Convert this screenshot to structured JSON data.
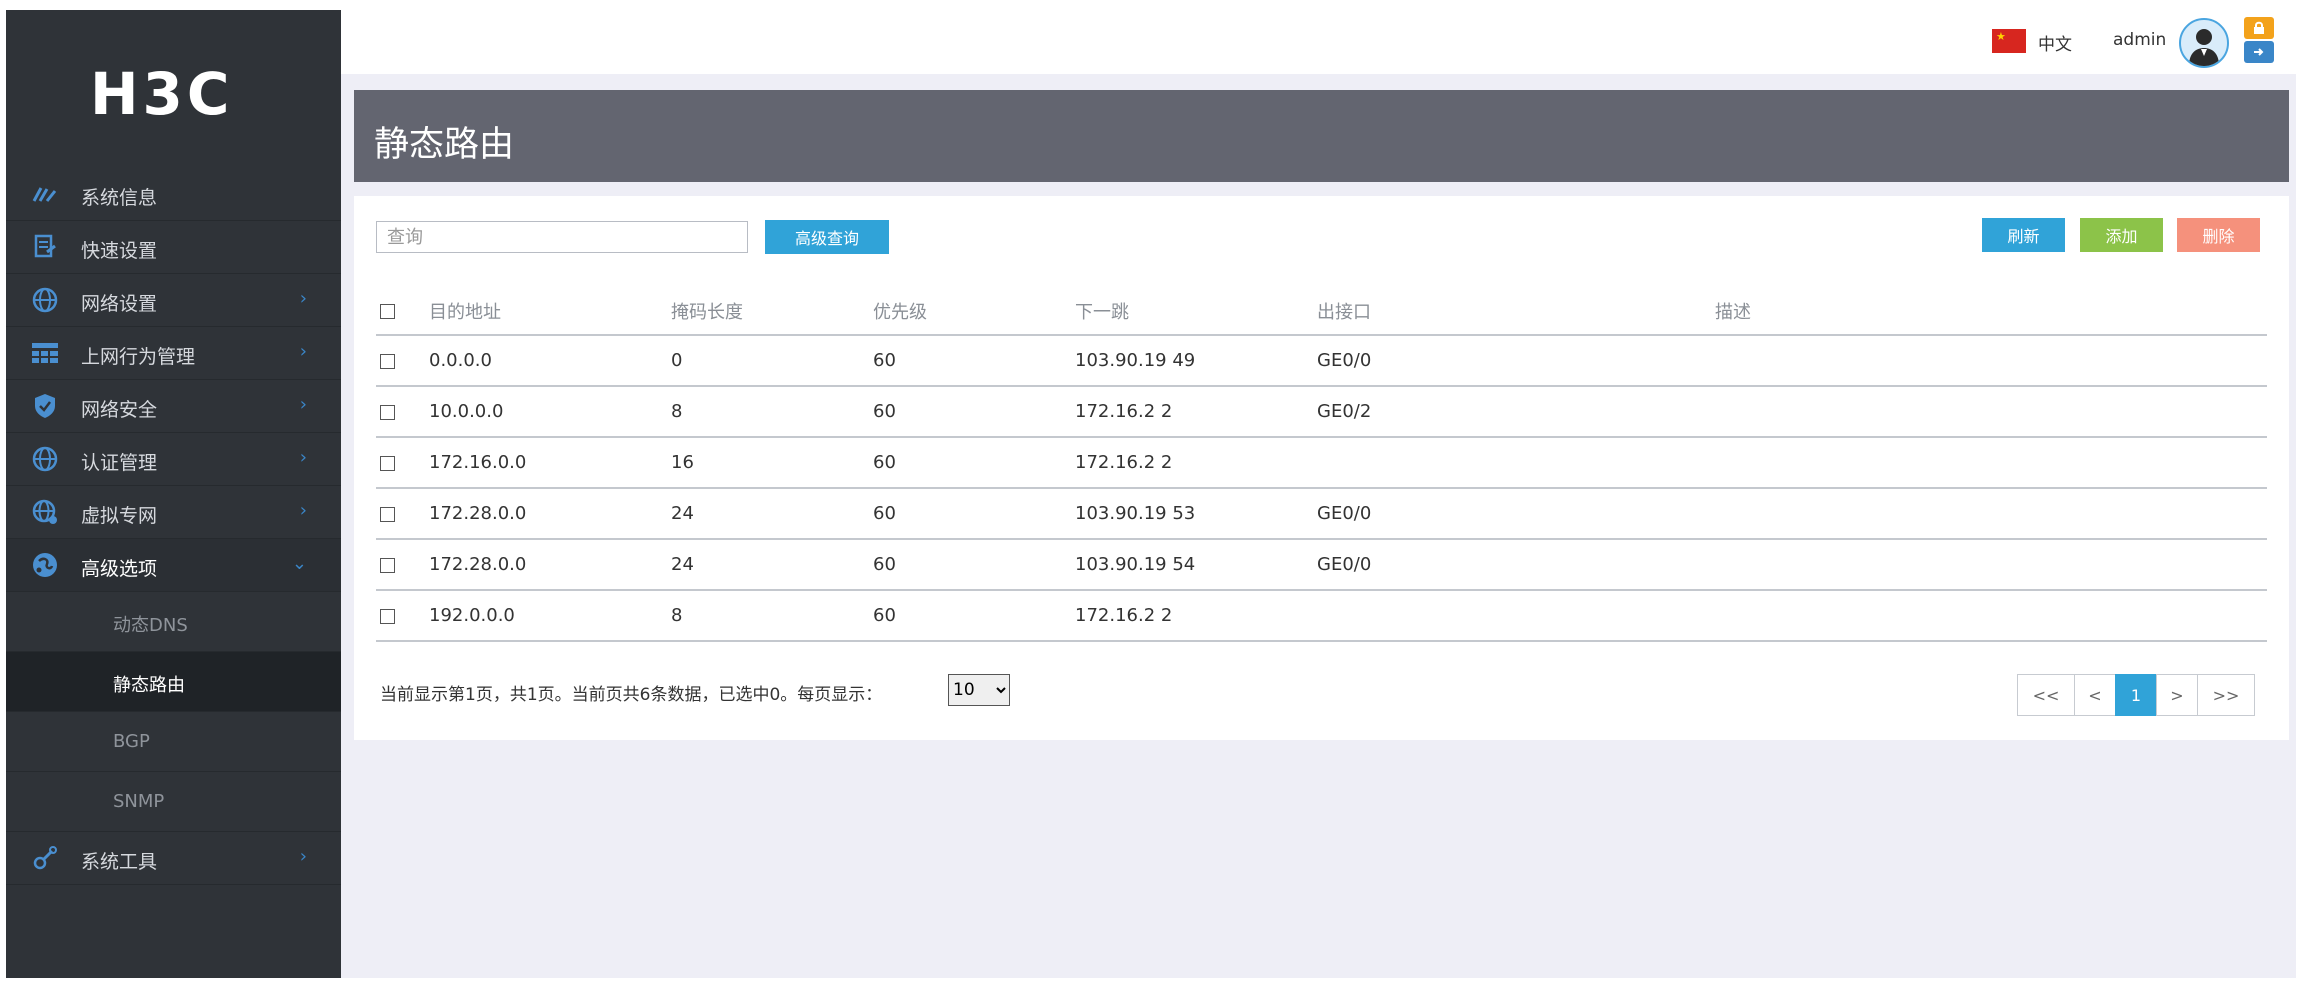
{
  "brand": {
    "logo_text": "H3C"
  },
  "header": {
    "language": "中文",
    "username": "admin",
    "avatar_icon": "user-avatar-icon",
    "lock_icon": "lock-icon",
    "logout_icon": "logout-icon"
  },
  "sidebar": {
    "items": [
      {
        "label": "系统信息",
        "icon": "speedometer-icon"
      },
      {
        "label": "快速设置",
        "icon": "quick-setup-icon"
      },
      {
        "label": "网络设置",
        "icon": "globe-icon",
        "chevron": "›"
      },
      {
        "label": "上网行为管理",
        "icon": "grid-icon",
        "chevron": "›"
      },
      {
        "label": "网络安全",
        "icon": "shield-icon",
        "chevron": "›"
      },
      {
        "label": "认证管理",
        "icon": "globe-icon",
        "chevron": "›"
      },
      {
        "label": "虚拟专网",
        "icon": "globe-network-icon",
        "chevron": "›"
      },
      {
        "label": "高级选项",
        "icon": "advanced-icon",
        "chevron": "⌄"
      },
      {
        "label": "系统工具",
        "icon": "tools-icon",
        "chevron": "›"
      }
    ],
    "sub_items": [
      {
        "label": "动态DNS"
      },
      {
        "label": "静态路由"
      },
      {
        "label": "BGP"
      },
      {
        "label": "SNMP"
      }
    ]
  },
  "page": {
    "title": "静态路由"
  },
  "toolbar": {
    "search_placeholder": "查询",
    "advanced_search": "高级查询",
    "refresh": "刷新",
    "add": "添加",
    "delete": "删除"
  },
  "table": {
    "headers": [
      "目的地址",
      "掩码长度",
      "优先级",
      "下一跳",
      "出接口",
      "描述"
    ],
    "rows": [
      [
        "0.0.0.0",
        "0",
        "60",
        "103.90.19  49",
        "GE0/0",
        ""
      ],
      [
        "10.0.0.0",
        "8",
        "60",
        "172.16.2  2",
        "GE0/2",
        ""
      ],
      [
        "172.16.0.0",
        "16",
        "60",
        "172.16.2  2",
        "",
        ""
      ],
      [
        "172.28.0.0",
        "24",
        "60",
        "103.90.19  53",
        "GE0/0",
        ""
      ],
      [
        "172.28.0.0",
        "24",
        "60",
        "103.90.19  54",
        "GE0/0",
        ""
      ],
      [
        "192.0.0.0",
        "8",
        "60",
        "172.16.2  2",
        "",
        ""
      ]
    ]
  },
  "footer": {
    "status": "当前显示第1页，共1页。当前页共6条数据，已选中0。每页显示：",
    "page_size": "10"
  },
  "pagination": {
    "first": "<<",
    "prev": "<",
    "current": "1",
    "next": ">",
    "last": ">>"
  },
  "colors": {
    "sidebar_bg": "#2f3338",
    "title_bar_bg": "#636570",
    "accent_blue": "#30a3d8",
    "add_green": "#8cc349",
    "delete_salmon": "#f5917c"
  }
}
